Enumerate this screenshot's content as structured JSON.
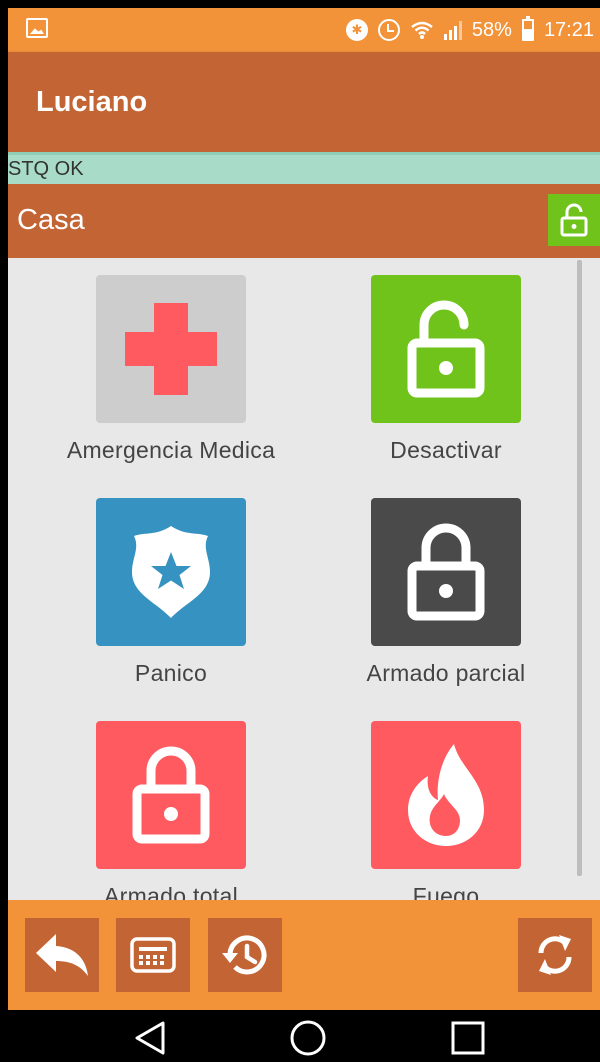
{
  "status_bar": {
    "battery": "58%",
    "time": "17:21",
    "background": "#f2933a"
  },
  "app_bar": {
    "title": "Luciano",
    "background": "#c26434"
  },
  "connection": {
    "status": "STQ OK",
    "background": "#a9dcc8"
  },
  "location": {
    "name": "Casa",
    "lock_state_icon": "unlock-icon",
    "lock_color": "#6fc31b"
  },
  "actions": [
    {
      "label": "Amergencia Medica",
      "icon": "medical-cross-icon",
      "color": "#cdcdcd"
    },
    {
      "label": "Desactivar",
      "icon": "unlock-icon",
      "color": "#6fc31b"
    },
    {
      "label": "Panico",
      "icon": "police-badge-icon",
      "color": "#3592c1"
    },
    {
      "label": "Armado parcial",
      "icon": "lock-icon",
      "color": "#4a4a4a"
    },
    {
      "label": "Armado total",
      "icon": "lock-icon",
      "color": "#fe5a60"
    },
    {
      "label": "Fuego",
      "icon": "fire-icon",
      "color": "#fe5a60"
    }
  ],
  "bottom_bar": {
    "buttons": [
      "back-arrow-icon",
      "keypad-icon",
      "history-icon",
      "refresh-icon"
    ]
  },
  "nav_bar": {
    "buttons": [
      "nav-back-icon",
      "nav-home-icon",
      "nav-recents-icon"
    ]
  }
}
